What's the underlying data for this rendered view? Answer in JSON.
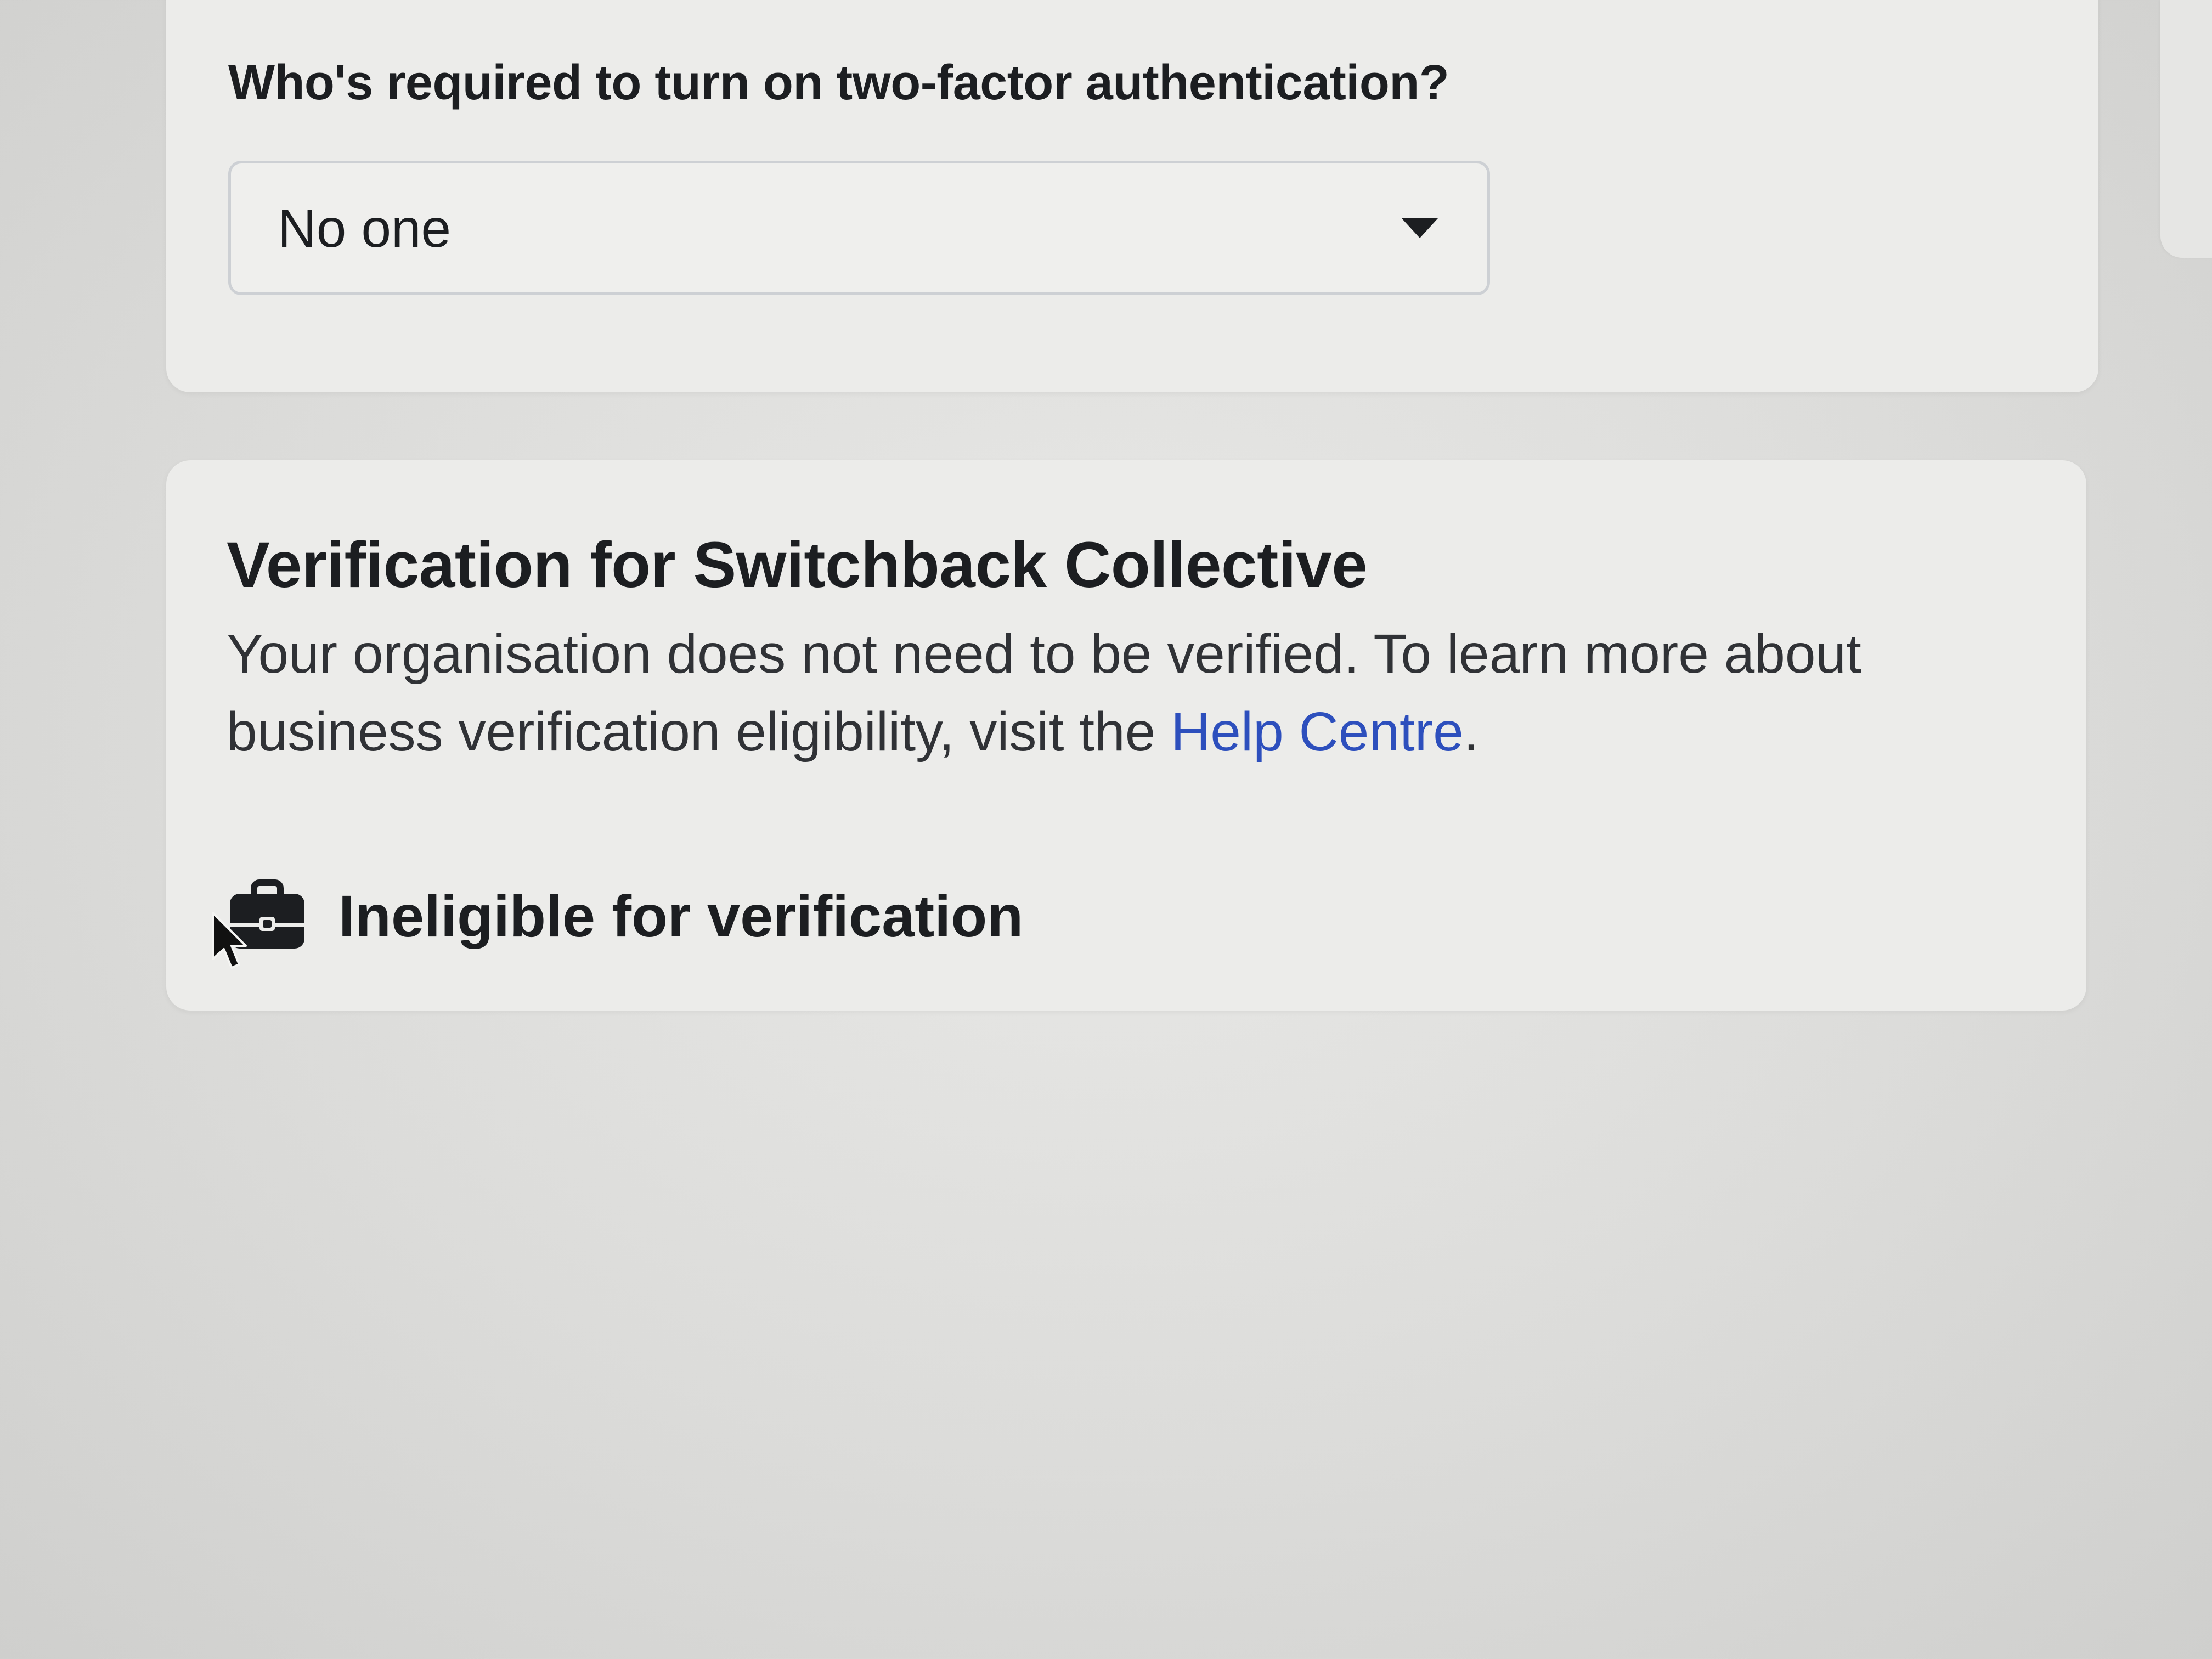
{
  "two_factor": {
    "question": "Who's required to turn on two-factor authentication?",
    "selected": "No one",
    "dropdown_icon": "caret-down-icon"
  },
  "verification": {
    "title": "Verification for Switchback Collective",
    "description_before_link": "Your organisation does not need to be verified. To learn more about business verification eligibility, visit the ",
    "link_text": "Help Centre",
    "description_after_link": ".",
    "link_color": "#2d4fbd",
    "status_icon": "briefcase-icon",
    "status_text": "Ineligible for verification"
  },
  "pointer": "mouse-cursor-icon"
}
